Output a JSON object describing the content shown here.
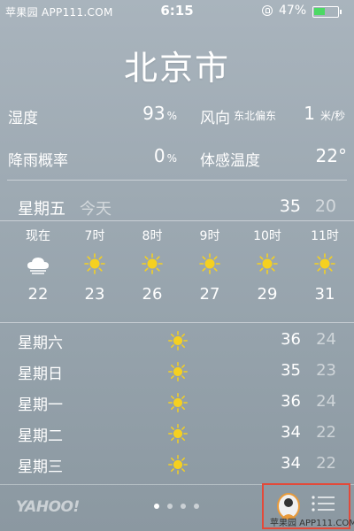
{
  "status_bar": {
    "carrier": "苹果园 APP111.COM",
    "time": "6:15",
    "battery_percent": "47%",
    "battery_level": 0.47,
    "battery_color": "#4cd964"
  },
  "city": "北京市",
  "details": {
    "humidity_label": "湿度",
    "humidity_value": "93",
    "humidity_unit": "%",
    "wind_label": "风向",
    "wind_direction": "东北偏东",
    "wind_value": "1",
    "wind_unit": "米/秒",
    "rain_label": "降雨概率",
    "rain_value": "0",
    "rain_unit": "%",
    "feels_label": "体感温度",
    "feels_value": "22°"
  },
  "today": {
    "day": "星期五",
    "tag": "今天",
    "high": "35",
    "low": "20"
  },
  "hourly": [
    {
      "time": "现在",
      "icon": "cloud-icon",
      "temp": "22"
    },
    {
      "time": "7时",
      "icon": "sun-icon",
      "temp": "23"
    },
    {
      "time": "8时",
      "icon": "sun-icon",
      "temp": "26"
    },
    {
      "time": "9时",
      "icon": "sun-icon",
      "temp": "27"
    },
    {
      "time": "10时",
      "icon": "sun-icon",
      "temp": "29"
    },
    {
      "time": "11时",
      "icon": "sun-icon",
      "temp": "31"
    }
  ],
  "daily": [
    {
      "day": "星期六",
      "icon": "sun-icon",
      "high": "36",
      "low": "24"
    },
    {
      "day": "星期日",
      "icon": "sun-icon",
      "high": "35",
      "low": "23"
    },
    {
      "day": "星期一",
      "icon": "sun-icon",
      "high": "36",
      "low": "24"
    },
    {
      "day": "星期二",
      "icon": "sun-icon",
      "high": "34",
      "low": "22"
    },
    {
      "day": "星期三",
      "icon": "sun-icon",
      "high": "34",
      "low": "22"
    }
  ],
  "footer": {
    "yahoo": "YAHOO!",
    "page_count": 4,
    "active_page": 0,
    "watermark": "苹果园 APP111.COM"
  },
  "colors": {
    "sun": "#f5d020",
    "highlight": "#e34a3a"
  }
}
